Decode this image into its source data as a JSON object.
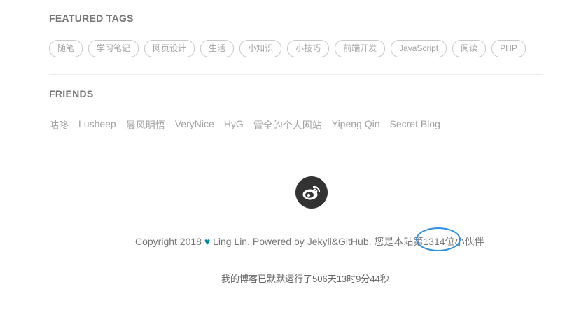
{
  "tags_section": {
    "title": "FEATURED TAGS",
    "tags": [
      "随笔",
      "学习笔记",
      "网页设计",
      "生活",
      "小知识",
      "小技巧",
      "前端开发",
      "JavaScript",
      "阅读",
      "PHP"
    ]
  },
  "friends_section": {
    "title": "FRIENDS",
    "links": [
      "咕咚",
      "Lusheep",
      "晨风明悟",
      "VeryNice",
      "HyG",
      "雷全的个人网站",
      "Yipeng Qin",
      "Secret Blog"
    ]
  },
  "social": {
    "weibo_icon": "weibo-icon"
  },
  "footer": {
    "copyright_prefix": "Copyright 2018",
    "heart": "♥",
    "copyright_suffix": "Ling Lin. Powered by Jekyll&GitHub. 您是本站第",
    "visitor_count": "1314",
    "visitor_suffix": "位小伙伴",
    "runtime": "我的博客已默默运行了506天13时9分44秒"
  },
  "colors": {
    "heart": "#0085a1",
    "annotation": "#2b8fe4"
  }
}
